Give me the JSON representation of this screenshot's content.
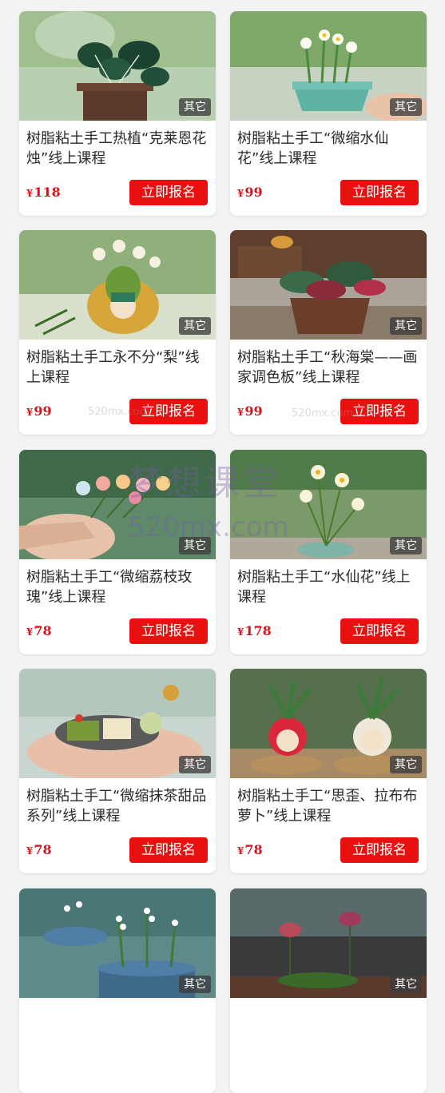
{
  "currency_symbol": "¥",
  "accent_color": "#e8110f",
  "price_color": "#d4141c",
  "enroll_label": "立即报名",
  "watermark": {
    "brand": "梦想课堂",
    "domain": "520mx.com",
    "small": "520mx.com"
  },
  "courses": [
    {
      "title": "树脂粘土手工热植“克莱恩花烛”线上课程",
      "price": "118",
      "badge": "其它",
      "image": "anthurium-plant-image"
    },
    {
      "title": "树脂粘土手工“微缩水仙花”线上课程",
      "price": "99",
      "badge": "其它",
      "image": "narcissus-pot-image"
    },
    {
      "title": "树脂粘土手工永不分“梨”线上课程",
      "price": "99",
      "badge": "其它",
      "image": "pear-flower-image"
    },
    {
      "title": "树脂粘土手工“秋海棠——画家调色板”线上课程",
      "price": "99",
      "badge": "其它",
      "image": "begonia-pot-image"
    },
    {
      "title": "树脂粘土手工“微缩荔枝玫瑰”线上课程",
      "price": "78",
      "badge": "其它",
      "image": "mini-roses-image"
    },
    {
      "title": "树脂粘土手工“水仙花”线上课程",
      "price": "178",
      "badge": "其它",
      "image": "narcissus-image"
    },
    {
      "title": "树脂粘土手工“微缩抹茶甜品系列”线上课程",
      "price": "78",
      "badge": "其它",
      "image": "matcha-dessert-image"
    },
    {
      "title": "树脂粘土手工“思歪、拉布布萝卜”线上课程",
      "price": "78",
      "badge": "其它",
      "image": "radish-doll-image"
    },
    {
      "title": "",
      "price": "",
      "badge": "其它",
      "image": "lily-of-valley-image"
    },
    {
      "title": "",
      "price": "",
      "badge": "其它",
      "image": "orchid-image"
    }
  ]
}
